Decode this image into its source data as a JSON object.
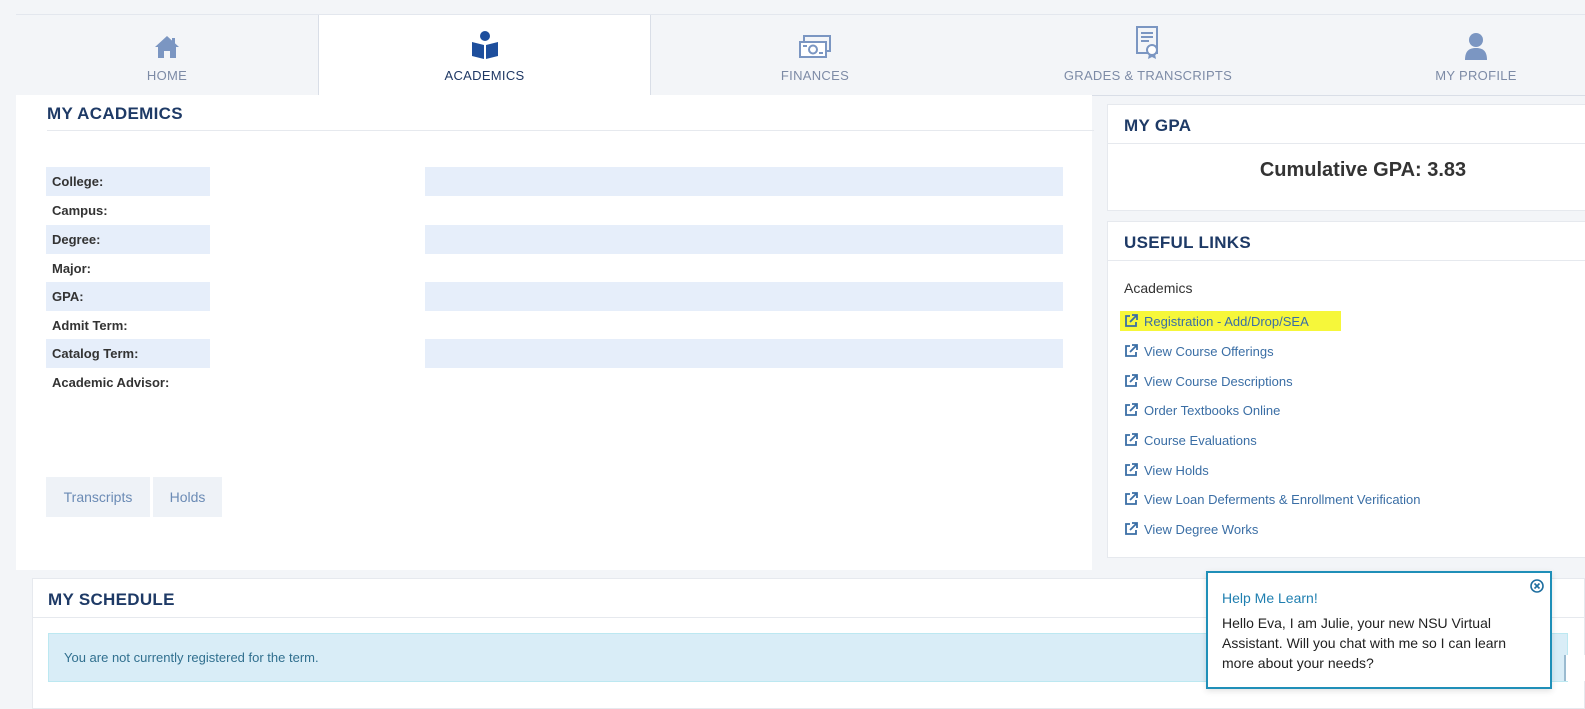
{
  "tabs": [
    {
      "label": "HOME",
      "icon": "home-icon",
      "active": false
    },
    {
      "label": "ACADEMICS",
      "icon": "book-reader-icon",
      "active": true
    },
    {
      "label": "FINANCES",
      "icon": "money-icon",
      "active": false
    },
    {
      "label": "GRADES & TRANSCRIPTS",
      "icon": "certificate-icon",
      "active": false
    },
    {
      "label": "MY PROFILE",
      "icon": "user-icon",
      "active": false
    }
  ],
  "academics": {
    "title": "MY ACADEMICS",
    "fields": [
      {
        "label": "College:"
      },
      {
        "label": "Campus:"
      },
      {
        "label": "Degree:"
      },
      {
        "label": "Major:"
      },
      {
        "label": "GPA:"
      },
      {
        "label": "Admit Term:"
      },
      {
        "label": "Catalog Term:"
      },
      {
        "label": "Academic Advisor:"
      }
    ],
    "buttons": {
      "transcripts": "Transcripts",
      "holds": "Holds"
    }
  },
  "gpa": {
    "title": "MY GPA",
    "text": "Cumulative GPA: 3.83"
  },
  "useful_links": {
    "title": "USEFUL LINKS",
    "group": "Academics",
    "items": [
      "Registration - Add/Drop/SEA",
      "View Course Offerings",
      "View Course Descriptions",
      "Order Textbooks Online",
      "Course Evaluations",
      "View Holds",
      "View Loan Deferments & Enrollment Verification",
      "View Degree Works"
    ],
    "highlighted_item": "Registration - Add/Drop/SEA",
    "highlight_color": "#f6f73a"
  },
  "schedule": {
    "title": "MY SCHEDULE",
    "notice": "You are not currently registered for the term."
  },
  "chat": {
    "title": "Help Me Learn!",
    "message": "Hello Eva, I am Julie, your new NSU Virtual Assistant. Will you chat with me so I can learn more about your needs?"
  },
  "colors": {
    "accent": "#1e3a66",
    "link": "#3a6ea5",
    "tab_inactive": "#7d8ba6",
    "icon": "#6f8fc0",
    "icon_active": "#1d4e9c"
  }
}
